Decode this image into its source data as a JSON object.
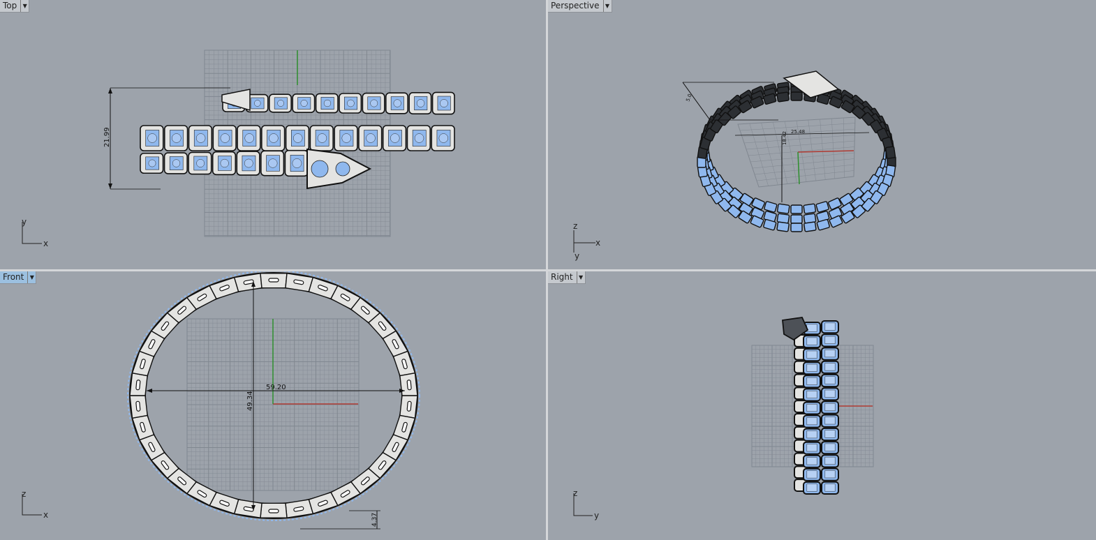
{
  "viewports": {
    "top": {
      "title": "Top",
      "dimension": "21.99",
      "axes": [
        "y",
        "x"
      ]
    },
    "perspective": {
      "title": "Perspective",
      "dimensions": [
        "5.0",
        "25.48",
        "18.42"
      ],
      "axes": [
        "z",
        "x",
        "y"
      ]
    },
    "front": {
      "title": "Front",
      "dimensions": [
        "59.20",
        "49.34",
        "4.37"
      ],
      "axes": [
        "z",
        "x"
      ]
    },
    "right": {
      "title": "Right",
      "axes": [
        "z",
        "y"
      ]
    }
  },
  "active_viewport": "Front",
  "colors": {
    "viewport_bg": "#9da3ab",
    "grid": "#808790",
    "x_axis": "#b03a32",
    "y_axis": "#2e8f2e",
    "segment_fill": "#e4e4e2",
    "gem": "#8fb8ee"
  },
  "icons": {
    "dropdown": "chevron-down-icon"
  }
}
